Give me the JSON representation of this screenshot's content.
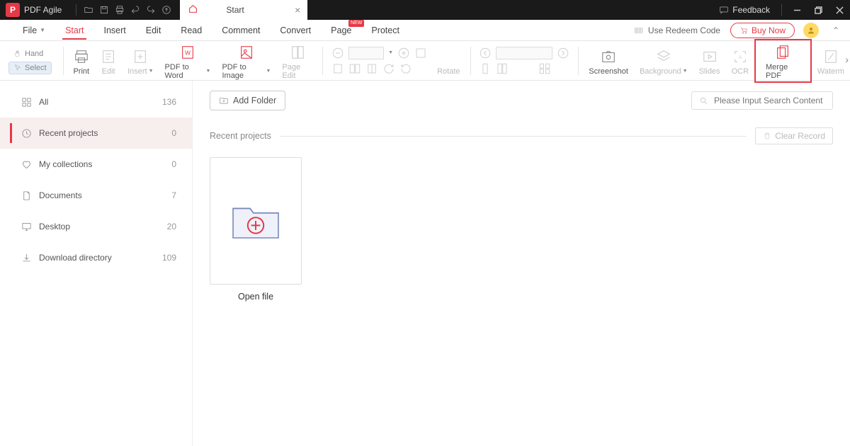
{
  "app": {
    "name": "PDF Agile",
    "logo_letter": "P"
  },
  "titlebar": {
    "feedback": "Feedback",
    "tab": {
      "title": "Start"
    }
  },
  "menubar": {
    "items": [
      {
        "label": "File",
        "has_caret": true
      },
      {
        "label": "Start",
        "active": true
      },
      {
        "label": "Insert"
      },
      {
        "label": "Edit"
      },
      {
        "label": "Read"
      },
      {
        "label": "Comment"
      },
      {
        "label": "Convert"
      },
      {
        "label": "Page",
        "badge": "NEW"
      },
      {
        "label": "Protect"
      }
    ],
    "redeem": "Use Redeem Code",
    "buy": "Buy Now"
  },
  "ribbon": {
    "hand": "Hand",
    "select": "Select",
    "print": "Print",
    "edit": "Edit",
    "insert": "Insert",
    "pdf_to_word": "PDF to Word",
    "pdf_to_image": "PDF to Image",
    "page_edit": "Page Edit",
    "rotate": "Rotate",
    "screenshot": "Screenshot",
    "background": "Background",
    "slides": "Slides",
    "ocr": "OCR",
    "merge_pdf": "Merge PDF",
    "waterm": "Waterm"
  },
  "sidebar": {
    "items": [
      {
        "label": "All",
        "count": "136"
      },
      {
        "label": "Recent projects",
        "count": "0",
        "active": true
      },
      {
        "label": "My collections",
        "count": "0"
      },
      {
        "label": "Documents",
        "count": "7"
      },
      {
        "label": "Desktop",
        "count": "20"
      },
      {
        "label": "Download directory",
        "count": "109"
      }
    ]
  },
  "main": {
    "add_folder": "Add Folder",
    "search_placeholder": "Please Input Search Content",
    "section_title": "Recent projects",
    "clear_record": "Clear Record",
    "open_file": "Open file"
  }
}
